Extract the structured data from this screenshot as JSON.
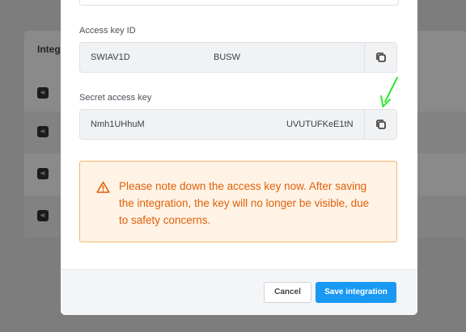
{
  "background": {
    "table_header": "Integ"
  },
  "modal": {
    "access_key": {
      "label": "Access key ID",
      "value_start": "SWIAV1D",
      "value_end": "BUSW",
      "copy_icon": "copy-icon"
    },
    "secret_key": {
      "label": "Secret access key",
      "value_start": "Nmh1UHhuM",
      "value_end": "UVUTUFKeE1tN",
      "copy_icon": "copy-icon"
    },
    "warning": {
      "icon": "warning-triangle-icon",
      "text": "Please note down the access key now. After saving the integration, the key will no longer be visible, due to safety concerns."
    },
    "footer": {
      "cancel_label": "Cancel",
      "save_label": "Save integration"
    }
  },
  "colors": {
    "accent": "#1a99f3",
    "warning_text": "#e0600a",
    "warning_border": "#f5b56d",
    "warning_bg": "#fff3e5",
    "annotation_arrow": "#2ee82e"
  }
}
